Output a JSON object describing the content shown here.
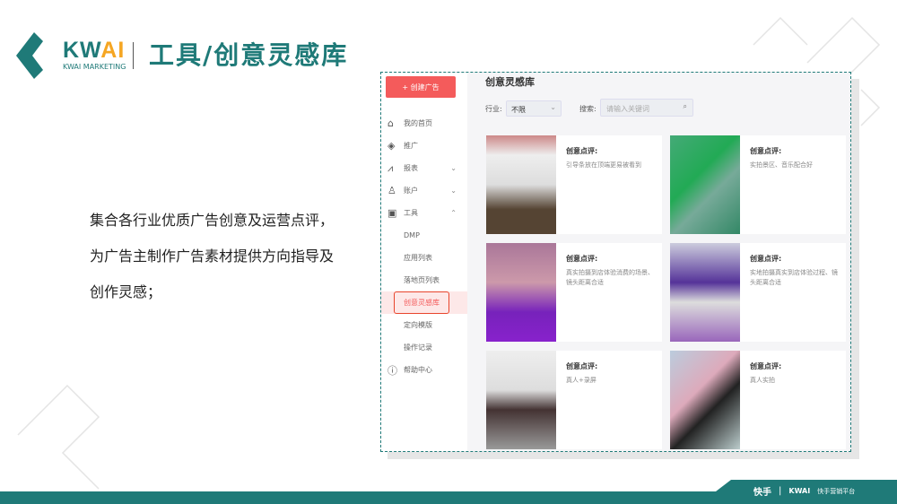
{
  "header": {
    "brand": "KW",
    "brand_accent": "AI",
    "brand_sub": "KWAI MARKETING",
    "title": "工具/创意灵感库"
  },
  "description": [
    "集合各行业优质广告创意及运营点评，",
    "为广告主制作广告素材提供方向指导及",
    "创作灵感；"
  ],
  "app": {
    "create_button": "+ 创建广告",
    "nav": [
      {
        "label": "我的首页",
        "icon": "home-icon"
      },
      {
        "label": "推广",
        "icon": "layers-icon"
      },
      {
        "label": "报表",
        "icon": "chart-icon",
        "chevron": "⌄"
      },
      {
        "label": "账户",
        "icon": "user-icon",
        "chevron": "⌄"
      },
      {
        "label": "工具",
        "icon": "toolbox-icon",
        "chevron": "⌃"
      },
      {
        "label": "DMP"
      },
      {
        "label": "应用列表"
      },
      {
        "label": "落地页列表"
      },
      {
        "label": "创意灵感库",
        "active": true
      },
      {
        "label": "定向模版"
      },
      {
        "label": "操作记录"
      },
      {
        "label": "帮助中心",
        "icon": "help-icon"
      }
    ],
    "page_title": "创意灵感库",
    "industry_label": "行业:",
    "industry_value": "不限",
    "search_label": "搜索:",
    "search_placeholder": "请输入关键词",
    "cards": [
      {
        "title": "创意点评:",
        "desc": "引导条放在顶端更易被看到"
      },
      {
        "title": "创意点评:",
        "desc": "实拍景区、音乐配合好"
      },
      {
        "title": "创意点评:",
        "desc": "真实拍摄到店体验消费的场景、镜头距离合适"
      },
      {
        "title": "创意点评:",
        "desc": "实地拍摄真实到店体验过程、镜头距离合适"
      },
      {
        "title": "创意点评:",
        "desc": "真人+录屏"
      },
      {
        "title": "创意点评:",
        "desc": "真人实拍"
      }
    ]
  },
  "footer": {
    "brand": "快手",
    "kwai": "KWAI",
    "platform": "快手营销平台"
  },
  "colors": {
    "brand": "#1f7a78",
    "accent": "#f45b5b"
  }
}
